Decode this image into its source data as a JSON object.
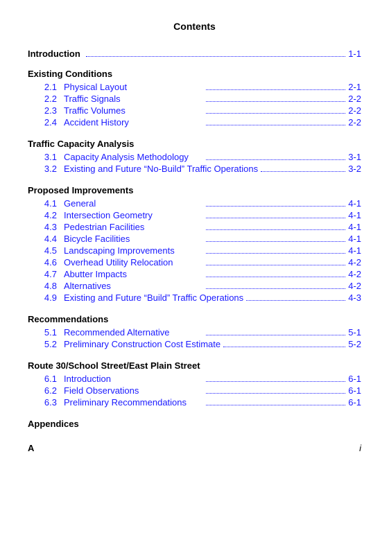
{
  "title": "Contents",
  "introduction": {
    "label": "Introduction",
    "page": "1-1"
  },
  "sections": [
    {
      "heading": "Existing Conditions",
      "entries": [
        {
          "num": "2.1",
          "label": "Physical Layout",
          "page": "2-1"
        },
        {
          "num": "2.2",
          "label": "Traffic Signals",
          "page": "2-2"
        },
        {
          "num": "2.3",
          "label": "Traffic Volumes",
          "page": "2-2"
        },
        {
          "num": "2.4",
          "label": "Accident History",
          "page": "2-2"
        }
      ]
    },
    {
      "heading": "Traffic Capacity Analysis",
      "entries": [
        {
          "num": "3.1",
          "label": "Capacity Analysis Methodology",
          "page": "3-1"
        },
        {
          "num": "3.2",
          "label": "Existing and Future “No-Build” Traffic Operations",
          "page": "3-2"
        }
      ]
    },
    {
      "heading": "Proposed Improvements",
      "entries": [
        {
          "num": "4.1",
          "label": "General",
          "page": "4-1"
        },
        {
          "num": "4.2",
          "label": "Intersection Geometry",
          "page": "4-1"
        },
        {
          "num": "4.3",
          "label": "Pedestrian Facilities",
          "page": "4-1"
        },
        {
          "num": "4.4",
          "label": "Bicycle Facilities",
          "page": "4-1"
        },
        {
          "num": "4.5",
          "label": "Landscaping Improvements",
          "page": "4-1"
        },
        {
          "num": "4.6",
          "label": "Overhead Utility Relocation",
          "page": "4-2"
        },
        {
          "num": "4.7",
          "label": "Abutter Impacts",
          "page": "4-2"
        },
        {
          "num": "4.8",
          "label": "Alternatives",
          "page": "4-2"
        },
        {
          "num": "4.9",
          "label": "Existing and Future “Build” Traffic Operations",
          "page": "4-3"
        }
      ]
    },
    {
      "heading": "Recommendations",
      "entries": [
        {
          "num": "5.1",
          "label": "Recommended Alternative",
          "page": "5-1"
        },
        {
          "num": "5.2",
          "label": "Preliminary Construction Cost Estimate",
          "page": "5-2"
        }
      ]
    },
    {
      "heading": "Route 30/School Street/East Plain Street",
      "entries": [
        {
          "num": "6.1",
          "label": "Introduction",
          "page": "6-1"
        },
        {
          "num": "6.2",
          "label": "Field Observations",
          "page": "6-1"
        },
        {
          "num": "6.3",
          "label": "Preliminary Recommendations",
          "page": "6-1"
        }
      ]
    },
    {
      "heading": "Appendices",
      "entries": []
    }
  ],
  "footer": {
    "left": "A",
    "right": "i"
  }
}
